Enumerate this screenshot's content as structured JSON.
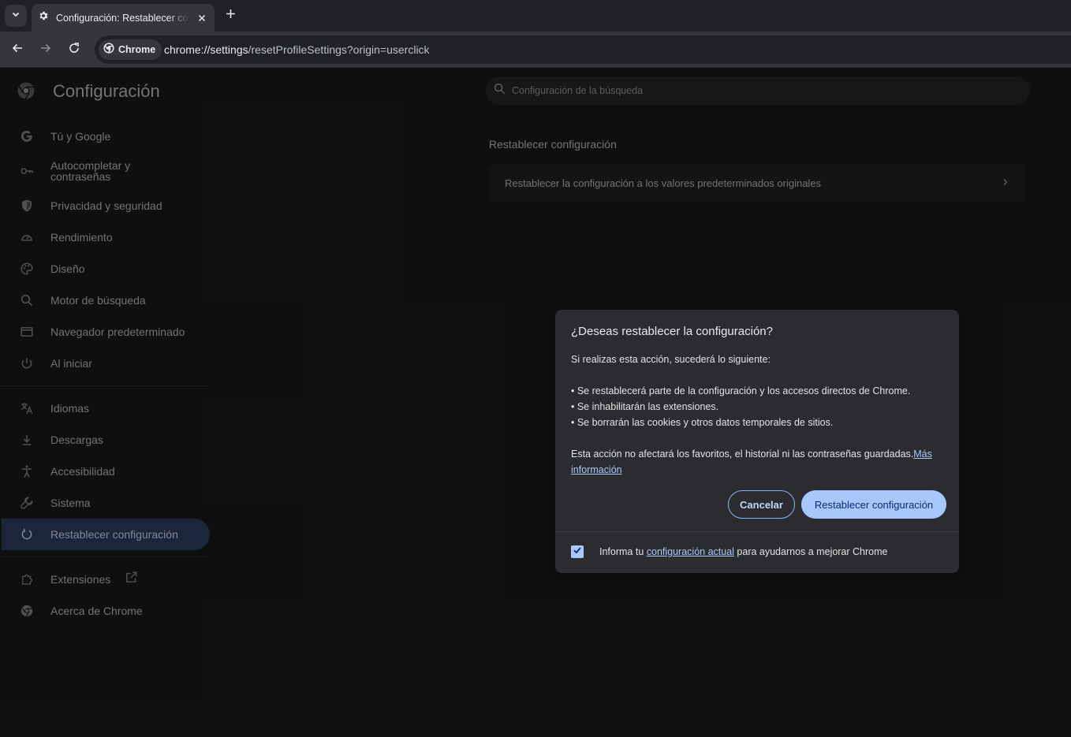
{
  "browser": {
    "tab_title": "Configuración: Restablecer configuración",
    "chip_label": "Chrome",
    "url_host": "chrome://settings",
    "url_path": "/resetProfileSettings?origin=userclick"
  },
  "header": {
    "title": "Configuración",
    "search_placeholder": "Configuración de la búsqueda"
  },
  "sidebar": {
    "items": [
      {
        "label": "Tú y Google",
        "icon": "google-icon"
      },
      {
        "label": "Autocompletar y contraseñas",
        "icon": "key-icon"
      },
      {
        "label": "Privacidad y seguridad",
        "icon": "shield-icon"
      },
      {
        "label": "Rendimiento",
        "icon": "speedometer-icon"
      },
      {
        "label": "Diseño",
        "icon": "palette-icon"
      },
      {
        "label": "Motor de búsqueda",
        "icon": "search-icon"
      },
      {
        "label": "Navegador predeterminado",
        "icon": "browser-window-icon"
      },
      {
        "label": "Al iniciar",
        "icon": "power-icon"
      },
      {
        "label": "Idiomas",
        "icon": "translate-icon"
      },
      {
        "label": "Descargas",
        "icon": "download-icon"
      },
      {
        "label": "Accesibilidad",
        "icon": "accessibility-icon"
      },
      {
        "label": "Sistema",
        "icon": "wrench-icon"
      },
      {
        "label": "Restablecer configuración",
        "icon": "reset-icon"
      },
      {
        "label": "Extensiones",
        "icon": "puzzle-icon"
      },
      {
        "label": "Acerca de Chrome",
        "icon": "chrome-icon"
      }
    ]
  },
  "main": {
    "section_title": "Restablecer configuración",
    "card_label": "Restablecer la configuración a los valores predeterminados originales"
  },
  "dialog": {
    "title": "¿Deseas restablecer la configuración?",
    "intro": "Si realizas esta acción, sucederá lo siguiente:",
    "bullets": [
      "• Se restablecerá parte de la configuración y los accesos directos de Chrome.",
      "• Se inhabilitarán las extensiones.",
      "• Se borrarán las cookies y otros datos temporales de sitios."
    ],
    "note": "Esta acción no afectará los favoritos, el historial ni las contraseñas guardadas.",
    "learn_more": "Más información",
    "cancel_label": "Cancelar",
    "reset_label": "Restablecer configuración",
    "footer_prefix": "Informa tu ",
    "footer_link": "configuración actual",
    "footer_suffix": " para ayudarnos a mejorar Chrome",
    "report_checked": true
  },
  "colors": {
    "accent": "#a8c7fa",
    "active_nav": "#2f4365"
  }
}
